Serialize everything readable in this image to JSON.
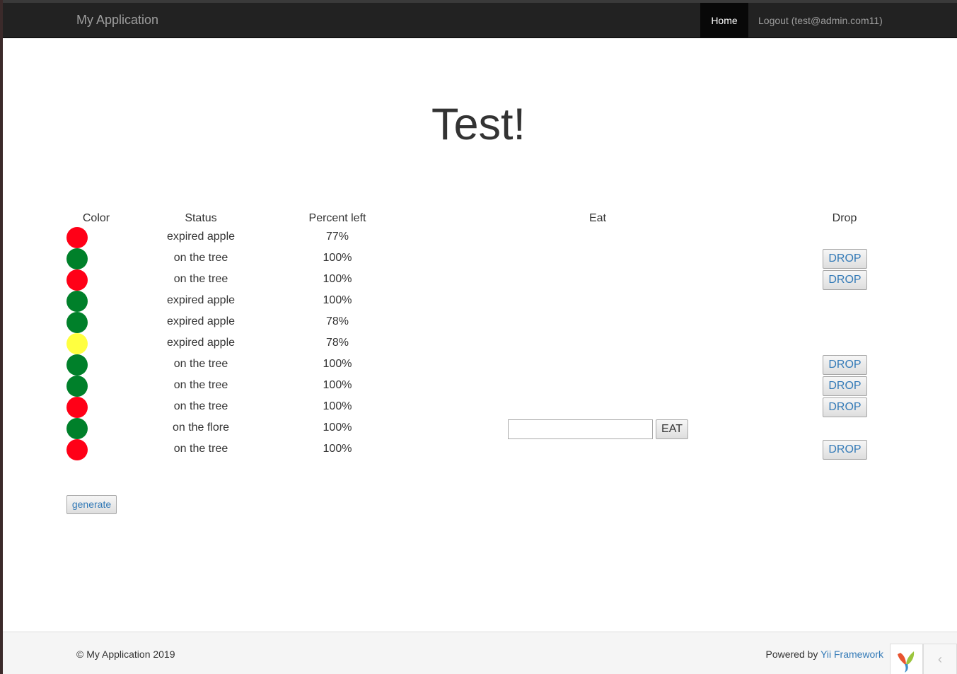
{
  "navbar": {
    "brand": "My Application",
    "home_label": "Home",
    "logout_label": "Logout (test@admin.com11)"
  },
  "page_title": "Test!",
  "table": {
    "headers": {
      "color": "Color",
      "status": "Status",
      "percent": "Percent left",
      "eat": "Eat",
      "drop": "Drop"
    },
    "drop_label": "DROP",
    "eat_label": "EAT",
    "rows": [
      {
        "color": "#ff0017",
        "status": "expired apple",
        "percent": "77%"
      },
      {
        "color": "#00802a",
        "status": "on the tree",
        "percent": "100%"
      },
      {
        "color": "#ff0017",
        "status": "on the tree",
        "percent": "100%"
      },
      {
        "color": "#00802a",
        "status": "expired apple",
        "percent": "100%"
      },
      {
        "color": "#00802a",
        "status": "expired apple",
        "percent": "78%"
      },
      {
        "color": "#ffff40",
        "status": "expired apple",
        "percent": "78%"
      },
      {
        "color": "#00802a",
        "status": "on the tree",
        "percent": "100%"
      },
      {
        "color": "#00802a",
        "status": "on the tree",
        "percent": "100%"
      },
      {
        "color": "#ff0017",
        "status": "on the tree",
        "percent": "100%"
      },
      {
        "color": "#00802a",
        "status": "on the flore",
        "percent": "100%"
      },
      {
        "color": "#ff0017",
        "status": "on the tree",
        "percent": "100%"
      }
    ]
  },
  "generate_label": "generate",
  "footer": {
    "copyright": "© My Application 2019",
    "powered_prefix": "Powered by ",
    "powered_link": "Yii Framework"
  },
  "icons": {
    "yii_logo": "yii-logo-icon",
    "collapse": "chevron-left-icon"
  },
  "colors": {
    "red": "#ff0017",
    "green": "#00802a",
    "yellow": "#ffff40",
    "link": "#337ab7",
    "navbar": "#222222"
  }
}
